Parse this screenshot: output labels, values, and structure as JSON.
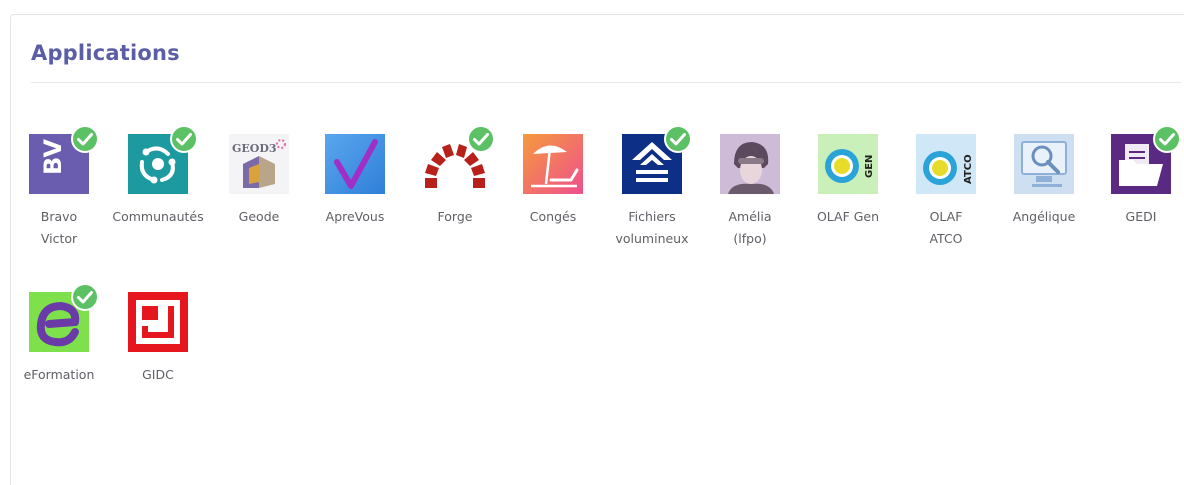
{
  "page": {
    "title": "Applications",
    "title_color": "#5b5ea6"
  },
  "status_badge_icon": "check-circle-icon",
  "status_badge_color": "#5cc165",
  "apps": [
    {
      "label": "Bravo\nVictor",
      "icon": "bravo-victor-logo",
      "installed": true
    },
    {
      "label": "Communautés",
      "icon": "communautes-logo",
      "installed": true
    },
    {
      "label": "Geode",
      "icon": "geode-logo",
      "logo_text": "GEOD3",
      "installed": false
    },
    {
      "label": "ApreVous",
      "icon": "aprevous-checkmark-logo",
      "installed": false
    },
    {
      "label": "Forge",
      "icon": "forge-arch-logo",
      "installed": true
    },
    {
      "label": "Congés",
      "icon": "conges-beach-logo",
      "installed": false
    },
    {
      "label": "Fichiers\nvolumineux",
      "icon": "fichiers-upload-logo",
      "installed": true
    },
    {
      "label": "Amélia\n(lfpo)",
      "icon": "amelia-portrait-logo",
      "installed": false
    },
    {
      "label": "OLAF Gen",
      "icon": "olaf-gen-logo",
      "logo_text": "GEN",
      "installed": false
    },
    {
      "label": "OLAF\nATCO",
      "icon": "olaf-atco-logo",
      "logo_text": "ATCO",
      "installed": false
    },
    {
      "label": "Angélique",
      "icon": "angelique-search-logo",
      "installed": false
    },
    {
      "label": "GEDI",
      "icon": "gedi-folder-logo",
      "installed": true
    },
    {
      "label": "eFormation",
      "icon": "eformation-logo",
      "installed": true
    },
    {
      "label": "GIDC",
      "icon": "gidc-logo",
      "installed": false
    }
  ]
}
